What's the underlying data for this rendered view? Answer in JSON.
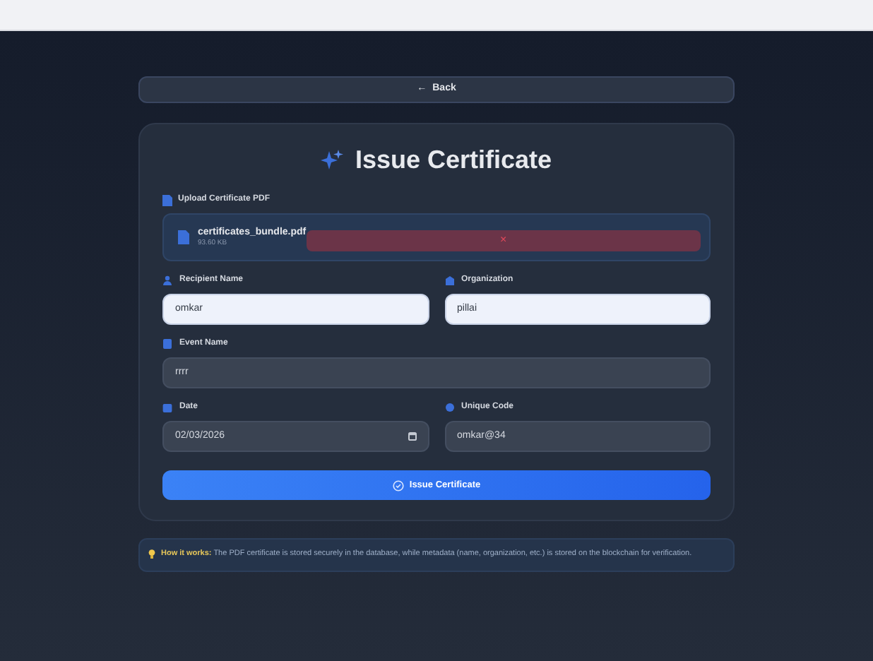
{
  "back_button": {
    "arrow": "←",
    "label": "Back"
  },
  "title": "Issue Certificate",
  "upload": {
    "label": "Upload Certificate PDF",
    "file_name": "certificates_bundle.pdf",
    "file_size": "93.60 KB",
    "remove": "×"
  },
  "fields": [
    {
      "label": "Recipient Name",
      "value": "omkar",
      "autofilled": true,
      "kind": "text"
    },
    {
      "label": "Organization",
      "value": "pillai",
      "autofilled": true,
      "kind": "text"
    },
    {
      "label": "Event Name",
      "value": "rrrr",
      "autofilled": false,
      "kind": "text",
      "wide": true
    },
    {
      "label": "Date",
      "value": "02/03/2026",
      "autofilled": false,
      "kind": "date"
    },
    {
      "label": "Unique Code",
      "value": "omkar@34",
      "autofilled": false,
      "kind": "text"
    }
  ],
  "submit_button": {
    "label": "Issue Certificate"
  },
  "info": {
    "text": "**How it works:** The PDF certificate is stored securely in the database, while metadata (name, organization, etc.) is stored on the blockchain for verification."
  }
}
